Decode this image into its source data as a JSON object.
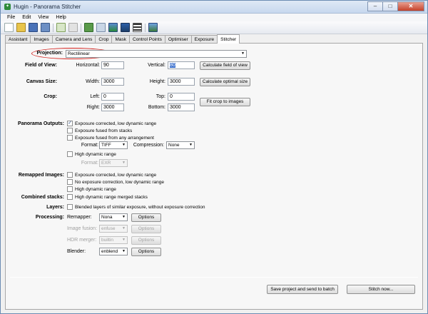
{
  "window": {
    "title": "Hugin - Panorama Stitcher"
  },
  "menu": [
    "File",
    "Edit",
    "View",
    "Help"
  ],
  "tabs": [
    "Assistant",
    "Images",
    "Camera and Lens",
    "Crop",
    "Mask",
    "Control Points",
    "Optimiser",
    "Exposure",
    "Stitcher"
  ],
  "active_tab": "Stitcher",
  "projection": {
    "label": "Projection:",
    "value": "Rectilinear"
  },
  "fov": {
    "label": "Field of View:",
    "horizontal_label": "Horizontal:",
    "horizontal": "90",
    "vertical_label": "Vertical:",
    "vertical": "80",
    "button": "Calculate field of view"
  },
  "canvas": {
    "label": "Canvas Size:",
    "width_label": "Width:",
    "width": "3000",
    "height_label": "Height:",
    "height": "3000",
    "button": "Calculate optimal size"
  },
  "crop": {
    "label": "Crop:",
    "left_label": "Left:",
    "left": "0",
    "top_label": "Top:",
    "top": "0",
    "right_label": "Right:",
    "right": "3000",
    "bottom_label": "Bottom:",
    "bottom": "3000",
    "button": "Fit crop to images"
  },
  "outputs": {
    "label": "Panorama Outputs:",
    "opt1": "Exposure corrected, low dynamic range",
    "opt1_checked": true,
    "opt2": "Exposure fused from stacks",
    "opt3": "Exposure fused from any arrangement",
    "format_label": "Format:",
    "format": "TIFF",
    "compression_label": "Compression:",
    "compression": "None",
    "hdr": "High dynamic range",
    "hdr_format_label": "Format:",
    "hdr_format": "EXR"
  },
  "remapped": {
    "label": "Remapped Images:",
    "opt1": "Exposure corrected, low dynamic range",
    "opt2": "No exposure correction, low dynamic range",
    "opt3": "High dynamic range"
  },
  "combined": {
    "label": "Combined stacks:",
    "opt1": "High dynamic range merged stacks"
  },
  "layers": {
    "label": "Layers:",
    "opt1": "Blended layers of similar exposure, without exposure correction"
  },
  "processing": {
    "label": "Processing:",
    "remapper_label": "Remapper:",
    "remapper": "Nona",
    "fusion_label": "Image fusion:",
    "fusion": "enfuse",
    "hdr_label": "HDR merger:",
    "hdr": "builtin",
    "blender_label": "Blender:",
    "blender": "enblend",
    "options": "Options"
  },
  "footer": {
    "batch_button": "Save project and send to batch",
    "stitch_button": "Stitch now..."
  },
  "colors": {
    "highlight_circle": "#d4231f",
    "selection": "#3a6fcc"
  }
}
